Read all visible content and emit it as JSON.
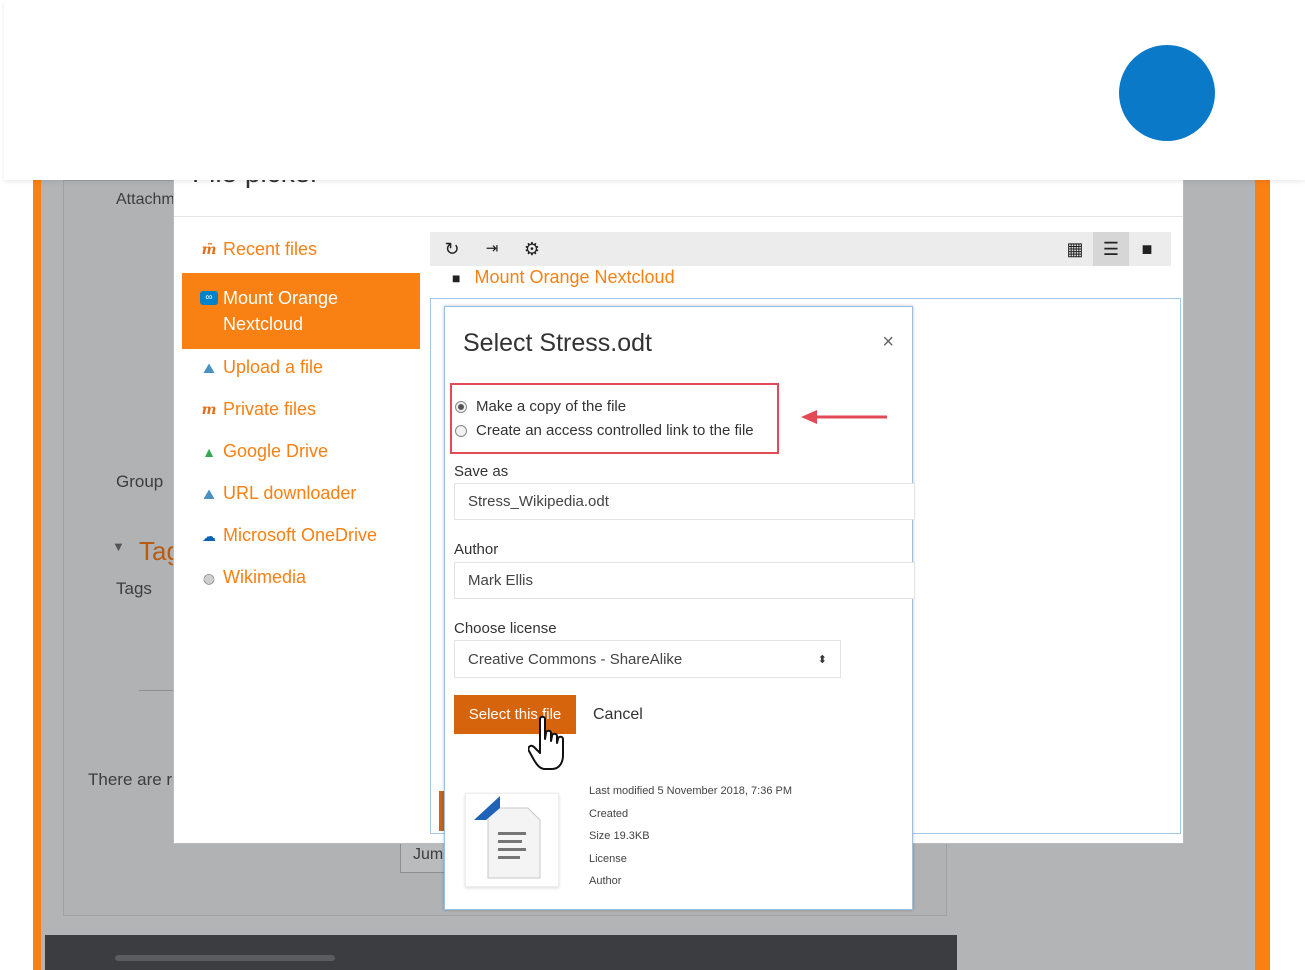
{
  "background_page": {
    "attachments_label": "Attachm",
    "group_label": "Group",
    "tags_heading": "Tags",
    "tags_label": "Tags",
    "notice_text": "There are re",
    "jump_label": "Jump t"
  },
  "file_picker": {
    "title": "File picker",
    "repositories": [
      {
        "label": "Recent files",
        "icon": "moodle-icon",
        "active": false
      },
      {
        "label": "Mount Orange Nextcloud",
        "icon": "nextcloud-icon",
        "active": true
      },
      {
        "label": "Upload a file",
        "icon": "upload-icon",
        "active": false
      },
      {
        "label": "Private files",
        "icon": "moodle-icon",
        "active": false
      },
      {
        "label": "Google Drive",
        "icon": "google-drive-icon",
        "active": false
      },
      {
        "label": "URL downloader",
        "icon": "url-downloader-icon",
        "active": false
      },
      {
        "label": "Microsoft OneDrive",
        "icon": "onedrive-icon",
        "active": false
      },
      {
        "label": "Wikimedia",
        "icon": "wikimedia-icon",
        "active": false
      }
    ],
    "toolbar": {
      "refresh_icon": "refresh-icon",
      "logout_icon": "logout-icon",
      "settings_icon": "gear-icon",
      "view_icons": [
        "grid-view-icon",
        "list-view-icon",
        "folder-view-icon"
      ]
    },
    "breadcrumb": "Mount Orange Nextcloud"
  },
  "select_dialog": {
    "title": "Select Stress.odt",
    "option_copy": "Make a copy of the file",
    "option_link": "Create an access controlled link to the file",
    "selected_option": "copy",
    "save_as_label": "Save as",
    "save_as_value": "Stress_Wikipedia.odt",
    "author_label": "Author",
    "author_value": "Mark Ellis",
    "license_label": "Choose license",
    "license_value": "Creative Commons - ShareAlike",
    "select_button": "Select this file",
    "cancel_button": "Cancel",
    "meta": {
      "last_modified": "Last modified  5 November 2018, 7:36 PM",
      "created": "Created",
      "size": "Size  19.3KB",
      "license": "License",
      "author": "Author"
    }
  },
  "colors": {
    "moodle_orange": "#f98012",
    "button_orange": "#d6640d",
    "highlight_red": "#e24b55",
    "accent_blue": "#0a7ac8"
  }
}
